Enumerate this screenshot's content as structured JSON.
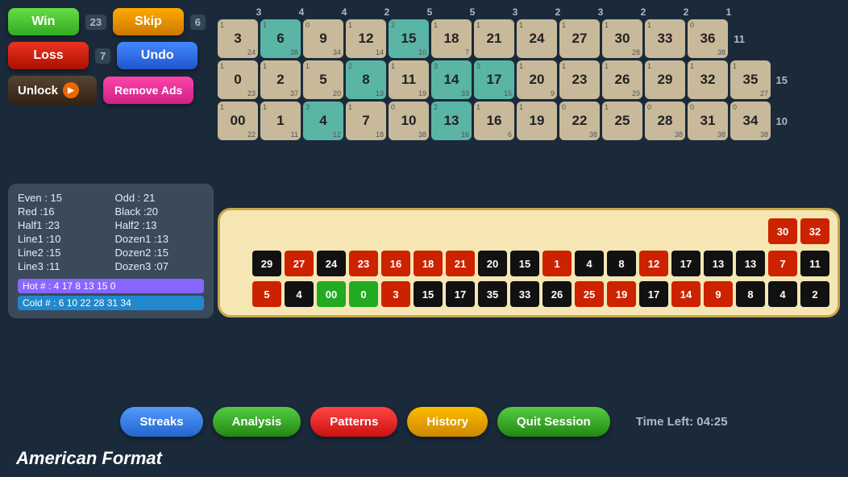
{
  "buttons": {
    "win": "Win",
    "loss": "Loss",
    "skip": "Skip",
    "undo": "Undo",
    "unlock": "Unlock",
    "remove_ads": "Remove Ads"
  },
  "badges": {
    "win_count": "23",
    "skip_count": "6",
    "loss_count": "7"
  },
  "stats": {
    "even": "Even : 15",
    "odd": "Odd : 21",
    "red": "Red :16",
    "black": "Black :20",
    "half1": "Half1 :23",
    "half2": "Half2 :13",
    "line1": "Line1 :10",
    "dozen1": "Dozen1 :13",
    "line2": "Line2 :15",
    "dozen2": "Dozen2 :15",
    "line3": "Line3 :11",
    "dozen3": "Dozen3 :07",
    "hot": "Hot # :   4 17 8 13 15 0",
    "cold": "Cold # :  6 10 22 28 31 34"
  },
  "col_headers": [
    "3",
    "4",
    "4",
    "2",
    "5",
    "5",
    "3",
    "2",
    "3",
    "2",
    "2",
    "1"
  ],
  "row_labels": [
    "11",
    "15",
    "10"
  ],
  "grid": [
    [
      {
        "top_l": "1",
        "main": "3",
        "bot": "24",
        "teal": false
      },
      {
        "top_l": "1",
        "main": "6",
        "bot": "38",
        "teal": true
      },
      {
        "top_l": "0",
        "main": "9",
        "bot": "34",
        "teal": false
      },
      {
        "top_l": "1",
        "main": "12",
        "bot": "14",
        "teal": false
      },
      {
        "top_l": "2",
        "main": "15",
        "bot": "10",
        "teal": true
      },
      {
        "top_l": "1",
        "main": "18",
        "bot": "7",
        "teal": false
      },
      {
        "top_l": "1",
        "main": "21",
        "bot": "",
        "teal": false
      },
      {
        "top_l": "1",
        "main": "24",
        "bot": "",
        "teal": false
      },
      {
        "top_l": "1",
        "main": "27",
        "bot": "",
        "teal": false
      },
      {
        "top_l": "1",
        "main": "30",
        "bot": "28",
        "teal": false
      },
      {
        "top_l": "1",
        "main": "33",
        "bot": "",
        "teal": false
      },
      {
        "top_l": "0",
        "main": "36",
        "bot": "38",
        "teal": false
      }
    ],
    [
      {
        "top_l": "1",
        "main": "0",
        "bot": "23",
        "teal": false
      },
      {
        "top_l": "1",
        "main": "2",
        "bot": "37",
        "teal": false
      },
      {
        "top_l": "1",
        "main": "5",
        "bot": "20",
        "teal": false
      },
      {
        "top_l": "2",
        "main": "8",
        "bot": "13",
        "teal": true
      },
      {
        "top_l": "1",
        "main": "11",
        "bot": "19",
        "teal": false
      },
      {
        "top_l": "3",
        "main": "14",
        "bot": "33",
        "teal": true
      },
      {
        "top_l": "3",
        "main": "17",
        "bot": "15",
        "teal": true
      },
      {
        "top_l": "1",
        "main": "20",
        "bot": "9",
        "teal": false
      },
      {
        "top_l": "1",
        "main": "23",
        "bot": "",
        "teal": false
      },
      {
        "top_l": "1",
        "main": "26",
        "bot": "29",
        "teal": false
      },
      {
        "top_l": "1",
        "main": "29",
        "bot": "",
        "teal": false
      },
      {
        "top_l": "1",
        "main": "32",
        "bot": "",
        "teal": false
      },
      {
        "top_l": "1",
        "main": "35",
        "bot": "27",
        "teal": false
      }
    ],
    [
      {
        "top_l": "1",
        "main": "00",
        "bot": "22",
        "teal": false
      },
      {
        "top_l": "1",
        "main": "1",
        "bot": "11",
        "teal": false
      },
      {
        "top_l": "3",
        "main": "4",
        "bot": "12",
        "teal": true
      },
      {
        "top_l": "1",
        "main": "7",
        "bot": "18",
        "teal": false
      },
      {
        "top_l": "0",
        "main": "10",
        "bot": "38",
        "teal": false
      },
      {
        "top_l": "2",
        "main": "13",
        "bot": "16",
        "teal": true
      },
      {
        "top_l": "1",
        "main": "16",
        "bot": "6",
        "teal": false
      },
      {
        "top_l": "1",
        "main": "19",
        "bot": "",
        "teal": false
      },
      {
        "top_l": "0",
        "main": "22",
        "bot": "38",
        "teal": false
      },
      {
        "top_l": "1",
        "main": "25",
        "bot": "",
        "teal": false
      },
      {
        "top_l": "0",
        "main": "28",
        "bot": "38",
        "teal": false
      },
      {
        "top_l": "0",
        "main": "31",
        "bot": "38",
        "teal": false
      },
      {
        "top_l": "0",
        "main": "34",
        "bot": "38",
        "teal": false
      }
    ]
  ],
  "wheel_top": [
    {
      "num": "30",
      "color": "red"
    },
    {
      "num": "32",
      "color": "red"
    }
  ],
  "wheel_row1": [
    {
      "num": "29",
      "color": "black"
    },
    {
      "num": "27",
      "color": "red"
    },
    {
      "num": "24",
      "color": "black"
    },
    {
      "num": "23",
      "color": "red"
    },
    {
      "num": "16",
      "color": "red"
    },
    {
      "num": "18",
      "color": "red"
    },
    {
      "num": "21",
      "color": "red"
    },
    {
      "num": "20",
      "color": "black"
    },
    {
      "num": "15",
      "color": "black"
    },
    {
      "num": "1",
      "color": "red"
    },
    {
      "num": "4",
      "color": "black"
    },
    {
      "num": "8",
      "color": "black"
    },
    {
      "num": "12",
      "color": "red"
    },
    {
      "num": "17",
      "color": "black"
    },
    {
      "num": "13",
      "color": "black"
    },
    {
      "num": "13",
      "color": "black"
    },
    {
      "num": "7",
      "color": "red"
    },
    {
      "num": "11",
      "color": "black"
    }
  ],
  "wheel_row2": [
    {
      "num": "5",
      "color": "red"
    },
    {
      "num": "4",
      "color": "black"
    },
    {
      "num": "00",
      "color": "green"
    },
    {
      "num": "0",
      "color": "green"
    },
    {
      "num": "3",
      "color": "red"
    },
    {
      "num": "15",
      "color": "black"
    },
    {
      "num": "17",
      "color": "black"
    },
    {
      "num": "35",
      "color": "black"
    },
    {
      "num": "33",
      "color": "black"
    },
    {
      "num": "26",
      "color": "black"
    },
    {
      "num": "25",
      "color": "red"
    },
    {
      "num": "19",
      "color": "red"
    },
    {
      "num": "17",
      "color": "black"
    },
    {
      "num": "14",
      "color": "red"
    },
    {
      "num": "9",
      "color": "red"
    },
    {
      "num": "8",
      "color": "black"
    },
    {
      "num": "4",
      "color": "black"
    },
    {
      "num": "2",
      "color": "black"
    }
  ],
  "nav": {
    "streaks": "Streaks",
    "analysis": "Analysis",
    "patterns": "Patterns",
    "history": "History",
    "quit": "Quit Session"
  },
  "timer": "Time Left: 04:25",
  "bottom_title": "American Format"
}
